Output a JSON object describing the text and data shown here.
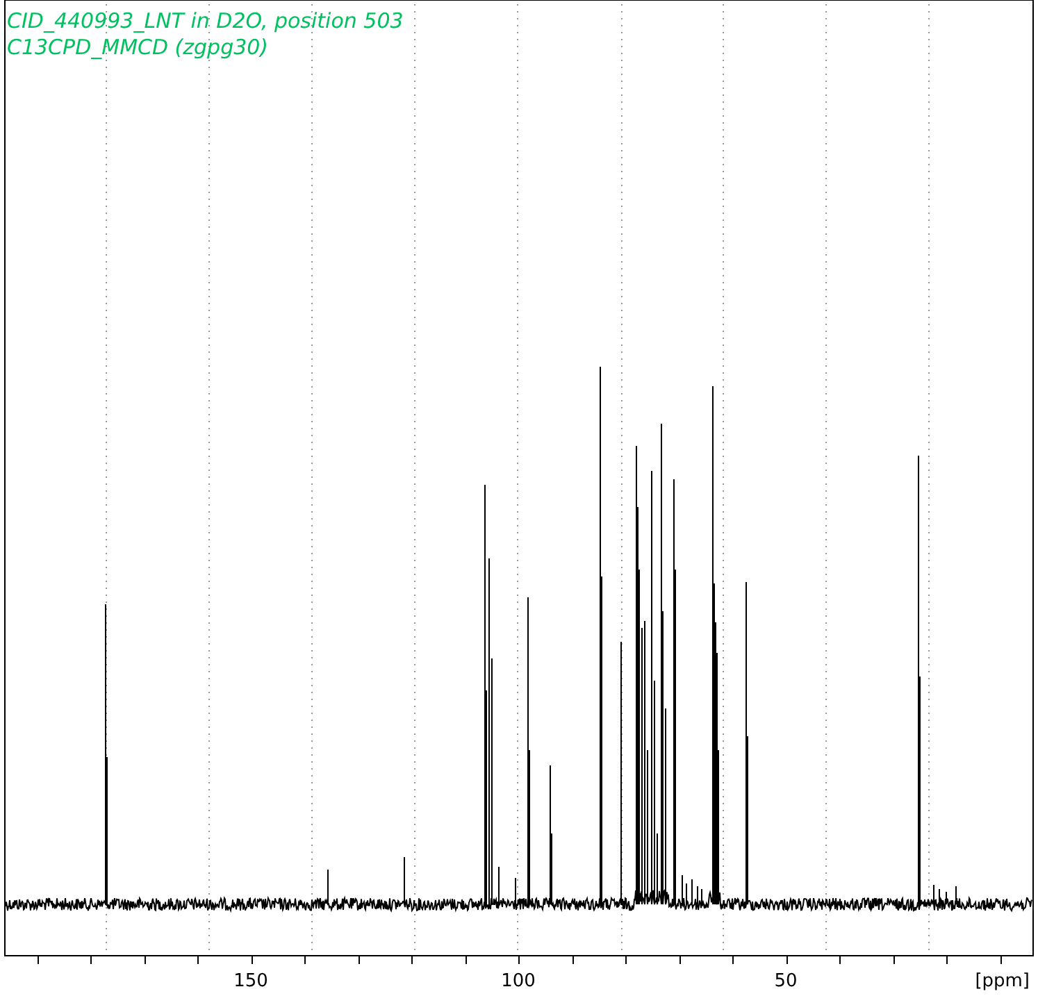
{
  "plot": {
    "title_lines": [
      "CID_440993_LNT in D2O, position 503",
      "C13CPD_MMCD (zgpg30)"
    ],
    "x_axis": {
      "tick_labels": [
        "150",
        "100",
        "50"
      ],
      "unit": "[ppm]"
    }
  }
}
